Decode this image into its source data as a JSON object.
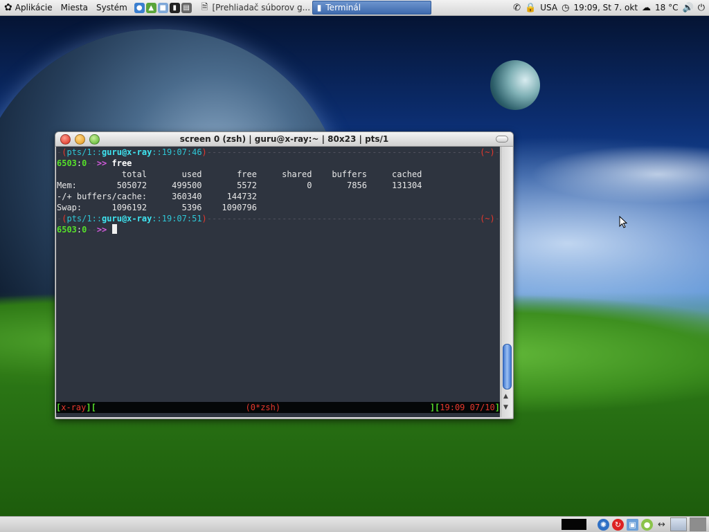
{
  "top_panel": {
    "menus": [
      {
        "label": "Aplikácie",
        "icon": "gnome-foot-icon"
      },
      {
        "label": "Miesta"
      },
      {
        "label": "Systém"
      }
    ],
    "tasks": [
      {
        "label": "[Prehliadač súborov g...",
        "active": false,
        "icon": "file-manager-icon"
      },
      {
        "label": "Terminál",
        "active": true,
        "icon": "terminal-icon"
      }
    ],
    "keyboard_layout": "USA",
    "clock": "19:09, St  7. okt",
    "temperature": "18 °C"
  },
  "terminal": {
    "title": "screen 0 (zsh) | guru@x-ray:~ | 80x23 | pts/1",
    "prompts": [
      {
        "tty": "pts/1",
        "sep": "::",
        "user_host": "guru@x-ray",
        "time": "19:07:46",
        "right": "(~)",
        "pid": "6503",
        "status": "0",
        "arrows": ">>",
        "command": " free"
      },
      {
        "tty": "pts/1",
        "sep": "::",
        "user_host": "guru@x-ray",
        "time": "19:07:51",
        "right": "(~)",
        "pid": "6503",
        "status": "0",
        "arrows": ">>",
        "command": ""
      }
    ],
    "free_output": {
      "header": "             total       used       free     shared    buffers     cached",
      "mem": "Mem:        505072     499500       5572          0       7856     131304",
      "buffers_cache": "-/+ buffers/cache:     360340     144732",
      "swap": "Swap:      1096192       5396    1090796"
    },
    "status_bar": {
      "left_host": "x-ray",
      "window": "(0*zsh)",
      "clock": "19:09 07/10"
    }
  }
}
